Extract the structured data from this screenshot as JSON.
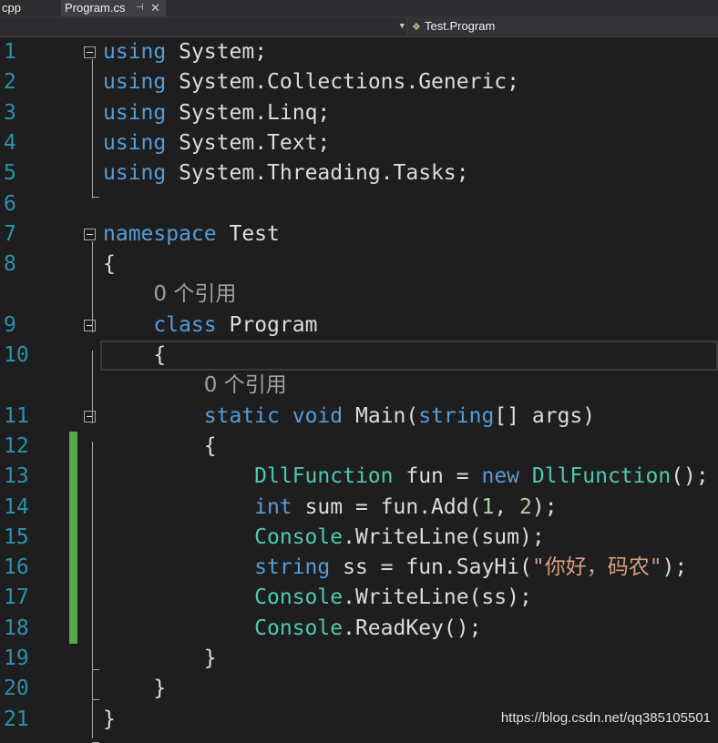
{
  "tabs": [
    {
      "label": "cpp"
    },
    {
      "label": "Program.cs",
      "pin_icon": "pin-icon",
      "close_icon": "close-icon"
    }
  ],
  "nav": {
    "member": "Test.Program"
  },
  "watermark": "https://blog.csdn.net/qq385105501",
  "colors": {
    "keyword": "#569cd6",
    "type": "#4ec9b0",
    "string": "#d69d85",
    "number": "#b5cea8",
    "text": "#dcdcdc",
    "line_number": "#2b91af",
    "change_bar": "#57a64a",
    "background": "#1e1e1e"
  },
  "code": [
    {
      "n": "1",
      "s": [
        [
          "kw",
          "using"
        ],
        [
          "",
          "System;"
        ]
      ]
    },
    {
      "n": "2",
      "s": [
        [
          "kw",
          "using"
        ],
        [
          "",
          "System.Collections.Generic;"
        ]
      ]
    },
    {
      "n": "3",
      "s": [
        [
          "kw",
          "using"
        ],
        [
          "",
          "System.Linq;"
        ]
      ]
    },
    {
      "n": "4",
      "s": [
        [
          "kw",
          "using"
        ],
        [
          "",
          "System.Text;"
        ]
      ]
    },
    {
      "n": "5",
      "s": [
        [
          "kw",
          "using"
        ],
        [
          "",
          "System.Threading.Tasks;"
        ]
      ]
    },
    {
      "n": "6",
      "s": []
    },
    {
      "n": "7",
      "s": [
        [
          "kw",
          "namespace"
        ],
        [
          "",
          "Test"
        ]
      ]
    },
    {
      "n": "8",
      "s": [
        [
          "",
          "{"
        ]
      ]
    },
    {
      "n": "",
      "s": [
        [
          "",
          "    "
        ],
        [
          "ref",
          "0 个引用"
        ]
      ]
    },
    {
      "n": "9",
      "s": [
        [
          "",
          "    "
        ],
        [
          "kw",
          "class"
        ],
        [
          "",
          "Program"
        ]
      ]
    },
    {
      "n": "10",
      "s": [
        [
          "",
          "    {"
        ]
      ]
    },
    {
      "n": "",
      "s": [
        [
          "",
          "        "
        ],
        [
          "ref",
          "0 个引用"
        ]
      ]
    },
    {
      "n": "11",
      "s": [
        [
          "",
          "        "
        ],
        [
          "kw",
          "static"
        ],
        [
          "kw",
          "void"
        ],
        [
          "",
          "Main("
        ],
        [
          "kw",
          "string"
        ],
        [
          "",
          "[] args)"
        ]
      ]
    },
    {
      "n": "12",
      "s": [
        [
          "",
          "        {"
        ]
      ]
    },
    {
      "n": "13",
      "s": [
        [
          "",
          "            "
        ],
        [
          "ty",
          "DllFunction"
        ],
        [
          "",
          "fun ="
        ],
        [
          "kw",
          "new"
        ],
        [
          "ty",
          "DllFunction"
        ],
        [
          "",
          "();"
        ]
      ]
    },
    {
      "n": "14",
      "s": [
        [
          "",
          "            "
        ],
        [
          "kw",
          "int"
        ],
        [
          "",
          "sum = fun.Add("
        ],
        [
          "nm",
          "1"
        ],
        [
          "",
          ","
        ],
        [
          "nm",
          "2"
        ],
        [
          "",
          ");"
        ]
      ]
    },
    {
      "n": "15",
      "s": [
        [
          "",
          "            "
        ],
        [
          "ty",
          "Console"
        ],
        [
          "",
          ".WriteLine(sum);"
        ]
      ]
    },
    {
      "n": "16",
      "s": [
        [
          "",
          "            "
        ],
        [
          "kw",
          "string"
        ],
        [
          "",
          "ss = fun.SayHi("
        ],
        [
          "str",
          "\"你好，码农\""
        ],
        [
          "",
          ");"
        ]
      ]
    },
    {
      "n": "17",
      "s": [
        [
          "",
          "            "
        ],
        [
          "ty",
          "Console"
        ],
        [
          "",
          ".WriteLine(ss);"
        ]
      ]
    },
    {
      "n": "18",
      "s": [
        [
          "",
          "            "
        ],
        [
          "ty",
          "Console"
        ],
        [
          "",
          ".ReadKey();"
        ]
      ]
    },
    {
      "n": "19",
      "s": [
        [
          "",
          "        }"
        ]
      ]
    },
    {
      "n": "20",
      "s": [
        [
          "",
          "    }"
        ]
      ]
    },
    {
      "n": "21",
      "s": [
        [
          "",
          "}"
        ]
      ]
    }
  ]
}
